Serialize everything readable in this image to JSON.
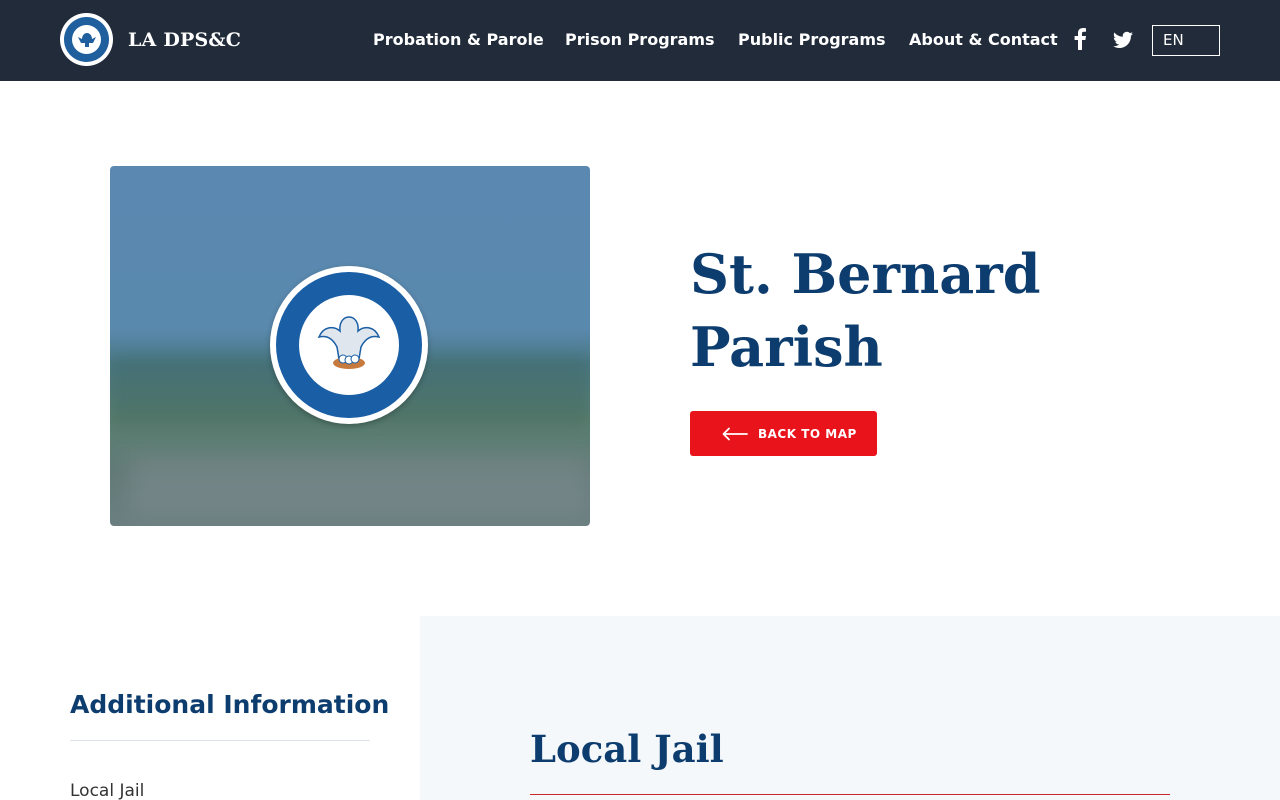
{
  "header": {
    "site_name": "LA DPS&C",
    "nav": [
      {
        "label": "Probation & Parole"
      },
      {
        "label": "Prison Programs"
      },
      {
        "label": "Public Programs"
      },
      {
        "label": "About & Contact"
      }
    ],
    "social": [
      "facebook-icon",
      "twitter-icon"
    ],
    "language": "EN"
  },
  "hero": {
    "title_line1": "St. Bernard",
    "title_line2": "Parish",
    "back_button": "BACK TO MAP"
  },
  "sidebar": {
    "title": "Additional Information",
    "items": [
      {
        "label": "Local Jail"
      }
    ]
  },
  "content": {
    "section_title": "Local Jail"
  },
  "colors": {
    "header_bg": "#212b3a",
    "title": "#0d3c6e",
    "accent_red": "#e8131b",
    "panel_bg": "#f5f8fb"
  }
}
